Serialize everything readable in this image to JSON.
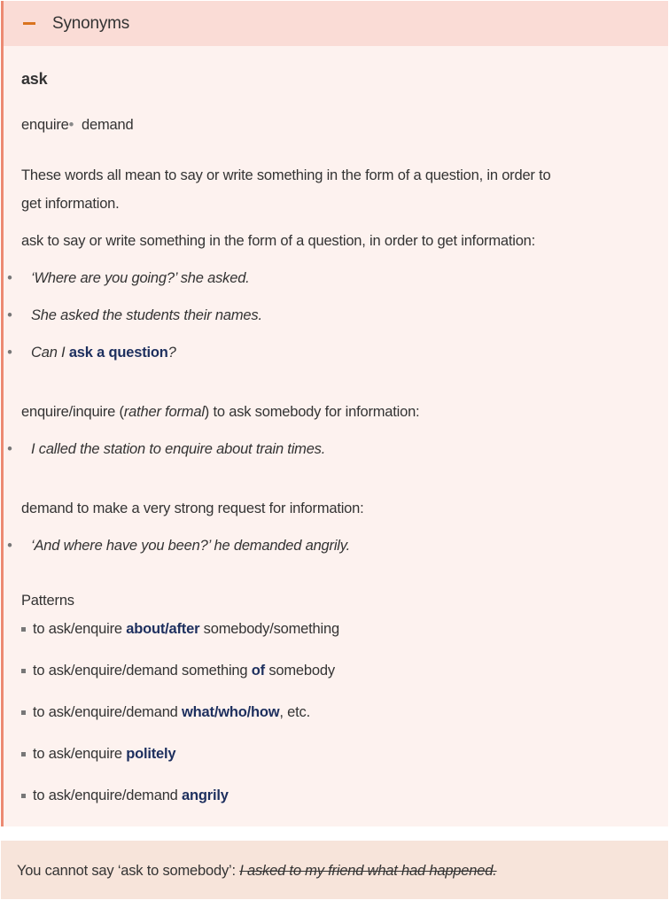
{
  "header": {
    "title": "Synonyms"
  },
  "headword": "ask",
  "synonyms": [
    "enquire",
    "demand"
  ],
  "intro": [
    "These words all mean to say or write something in the form of a question, in order to",
    "get information."
  ],
  "entries": [
    {
      "word": "ask",
      "def": " to say or write something in the form of a question, in order to get information:",
      "examples": [
        {
          "text": "‘Where are you going?’ she asked."
        },
        {
          "text": "She asked the students their names."
        },
        {
          "pre": "Can I ",
          "bold": "ask a question",
          "post": "?"
        }
      ]
    },
    {
      "word": "enquire/inquire",
      "label": "rather formal",
      "def": " to ask somebody for information:",
      "examples": [
        {
          "text": "I called the station to enquire about train times."
        }
      ]
    },
    {
      "word": "demand",
      "def": " to make a very strong request for information:",
      "examples": [
        {
          "text": "‘And where have you been?’ he demanded angrily."
        }
      ]
    }
  ],
  "patterns": {
    "title": "Patterns",
    "items": [
      {
        "pre": "to ask/enquire ",
        "bold": "about/after",
        "post": " somebody/something"
      },
      {
        "pre": "to ask/enquire/demand something ",
        "bold": "of",
        "post": " somebody"
      },
      {
        "pre": "to ask/enquire/demand ",
        "bold": "what/who/how",
        "post": ", etc."
      },
      {
        "pre": "to ask/enquire ",
        "bold": "politely",
        "post": ""
      },
      {
        "pre": "to ask/enquire/demand ",
        "bold": "angrily",
        "post": ""
      }
    ]
  },
  "note": {
    "text": "You cannot say ‘ask to somebody’: ",
    "struck": "I asked to my friend what had happened."
  }
}
